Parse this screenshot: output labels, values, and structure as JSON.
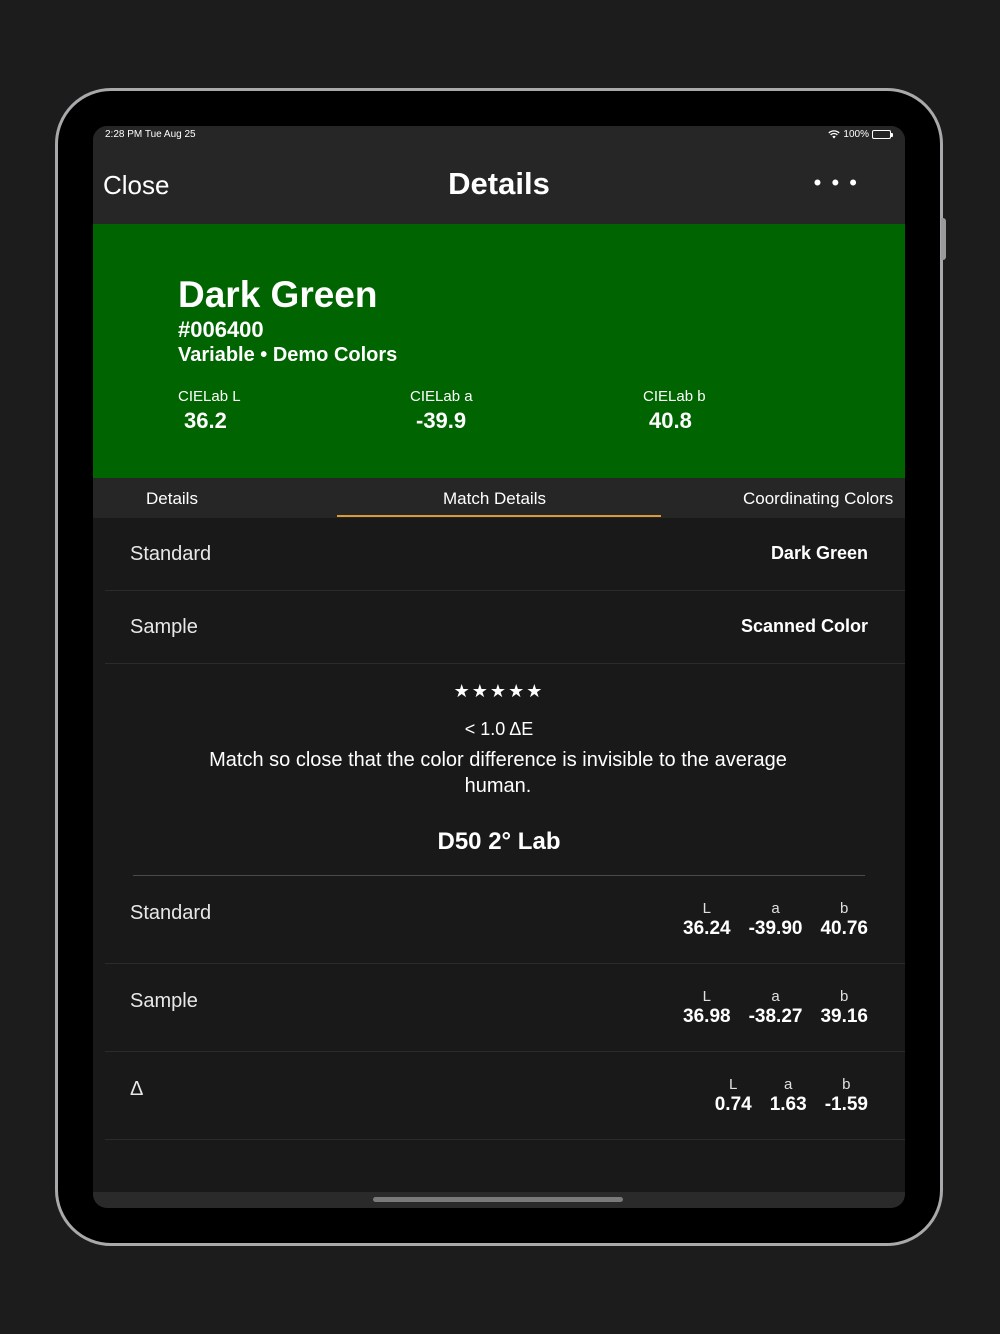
{
  "status": {
    "time": "2:28 PM   Tue Aug 25",
    "battery": "100%"
  },
  "nav": {
    "close_label": "Close",
    "title": "Details",
    "more_label": "• • •"
  },
  "colors": {
    "hero_bg": "#006400",
    "accent": "#d99b3a"
  },
  "hero": {
    "name": "Dark Green",
    "hex": "#006400",
    "subtitle": "Variable • Demo Colors",
    "lab": [
      {
        "label": "CIELab L",
        "value": "36.2"
      },
      {
        "label": "CIELab a",
        "value": "-39.9"
      },
      {
        "label": "CIELab b",
        "value": "40.8"
      }
    ]
  },
  "tabs": [
    {
      "label": "Details",
      "active": false
    },
    {
      "label": "Match Details",
      "active": true
    },
    {
      "label": "Coordinating Colors",
      "active": false
    }
  ],
  "match": {
    "standard_label": "Standard",
    "standard_value": "Dark Green",
    "sample_label": "Sample",
    "sample_value": "Scanned Color",
    "stars": "★★★★★",
    "rating_value": 5,
    "delta_e": "< 1.0 ΔE",
    "description": "Match so close that the color difference is invisible to the average human."
  },
  "lab_section": {
    "title": "D50 2° Lab",
    "rows": [
      {
        "label": "Standard",
        "L": "36.24",
        "a": "-39.90",
        "b": "40.76"
      },
      {
        "label": "Sample",
        "L": "36.98",
        "a": "-38.27",
        "b": "39.16"
      },
      {
        "label": "Δ",
        "L": "0.74",
        "a": "1.63",
        "b": "-1.59"
      }
    ],
    "headers": {
      "L": "L",
      "a": "a",
      "b": "b"
    }
  }
}
